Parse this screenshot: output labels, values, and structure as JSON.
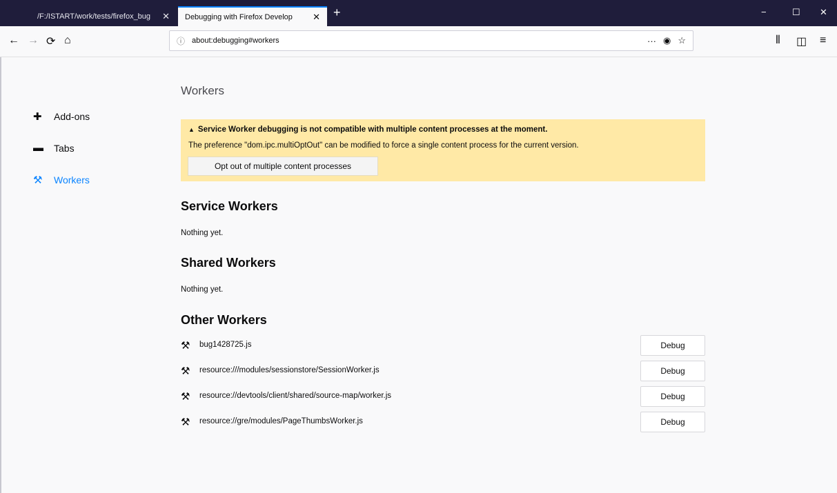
{
  "tabs": [
    {
      "title": "/F:/ISTART/work/tests/firefox_bug",
      "close": "✕"
    },
    {
      "title": "Debugging with Firefox Develop",
      "close": "✕"
    }
  ],
  "new_tab_icon": "+",
  "window": {
    "minimize": "−",
    "maximize": "☐",
    "close": "✕"
  },
  "nav": {
    "back": "←",
    "forward": "→",
    "reload": "⟳",
    "home": "⌂",
    "url": "about:debugging#workers",
    "info_icon": "ⓘ",
    "page_actions": "···",
    "pocket": "◉",
    "star": "☆",
    "library": "⫴",
    "sidebar_toggle": "◫",
    "menu": "≡"
  },
  "sidebar": {
    "items": [
      {
        "label": "Add-ons",
        "icon": "puzzle-icon",
        "glyph": "✚"
      },
      {
        "label": "Tabs",
        "icon": "tab-icon",
        "glyph": "▬"
      },
      {
        "label": "Workers",
        "icon": "tools-icon",
        "glyph": "⚒"
      }
    ]
  },
  "main": {
    "title": "Workers",
    "warning": {
      "icon": "▲",
      "title": "Service Worker debugging is not compatible with multiple content processes at the moment.",
      "body": "The preference \"dom.ipc.multiOptOut\" can be modified to force a single content process for the current version.",
      "button": "Opt out of multiple content processes"
    },
    "service_workers": {
      "heading": "Service Workers",
      "empty": "Nothing yet."
    },
    "shared_workers": {
      "heading": "Shared Workers",
      "empty": "Nothing yet."
    },
    "other_workers": {
      "heading": "Other Workers",
      "icon_glyph": "⚒",
      "items": [
        {
          "name": "bug1428725.js",
          "button": "Debug"
        },
        {
          "name": "resource:///modules/sessionstore/SessionWorker.js",
          "button": "Debug"
        },
        {
          "name": "resource://devtools/client/shared/source-map/worker.js",
          "button": "Debug"
        },
        {
          "name": "resource://gre/modules/PageThumbsWorker.js",
          "button": "Debug"
        }
      ]
    }
  },
  "colors": {
    "accent": "#0a84ff",
    "titlebar": "#1f1d3b",
    "warning_bg": "#ffe9a6"
  }
}
